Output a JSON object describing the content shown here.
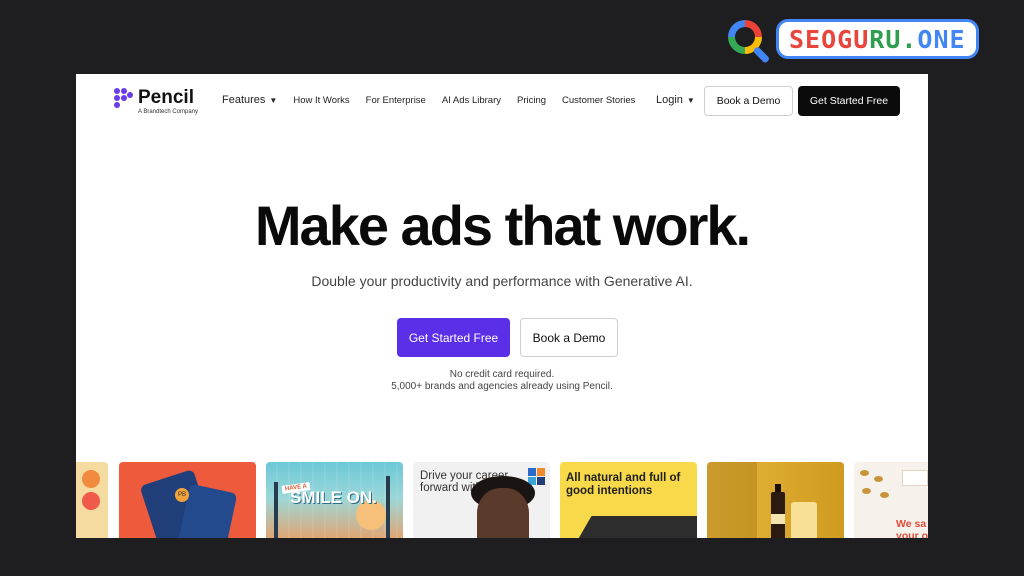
{
  "watermark": {
    "text_part1": "SEOGU",
    "text_part2": "RU.",
    "text_part3": "ONE"
  },
  "brand": {
    "name": "Pencil",
    "tagline": "A Brandtech Company"
  },
  "nav": {
    "items": [
      "Features",
      "How It Works",
      "For Enterprise",
      "AI Ads Library",
      "Pricing",
      "Customer Stories"
    ],
    "login_label": "Login",
    "book_demo_label": "Book a Demo",
    "get_started_label": "Get Started Free"
  },
  "hero": {
    "title": "Make ads that work.",
    "subtitle": "Double your productivity and performance with Generative AI.",
    "cta_primary": "Get Started Free",
    "cta_secondary": "Book a Demo",
    "note1": "No credit card required.",
    "note2": "5,000+ brands and agencies already using Pencil."
  },
  "gallery": {
    "card1_badge": "PB",
    "card2_tag": "HAVE A",
    "card2_text": "SMILE ON.",
    "card3_text": "Drive your career forward with PMI",
    "card4_text": "All natural and full of good intentions",
    "card6_text": "We sa your o"
  },
  "colors": {
    "accent_purple": "#5b2ee8",
    "brand_purple": "#6a3bea",
    "dark_button": "#0b0b0b",
    "page_background": "#1e1e21"
  },
  "icons": {
    "nav_dropdown": "chevron-down-icon",
    "watermark_search": "search-icon",
    "brand": "pencil-logo-icon"
  }
}
